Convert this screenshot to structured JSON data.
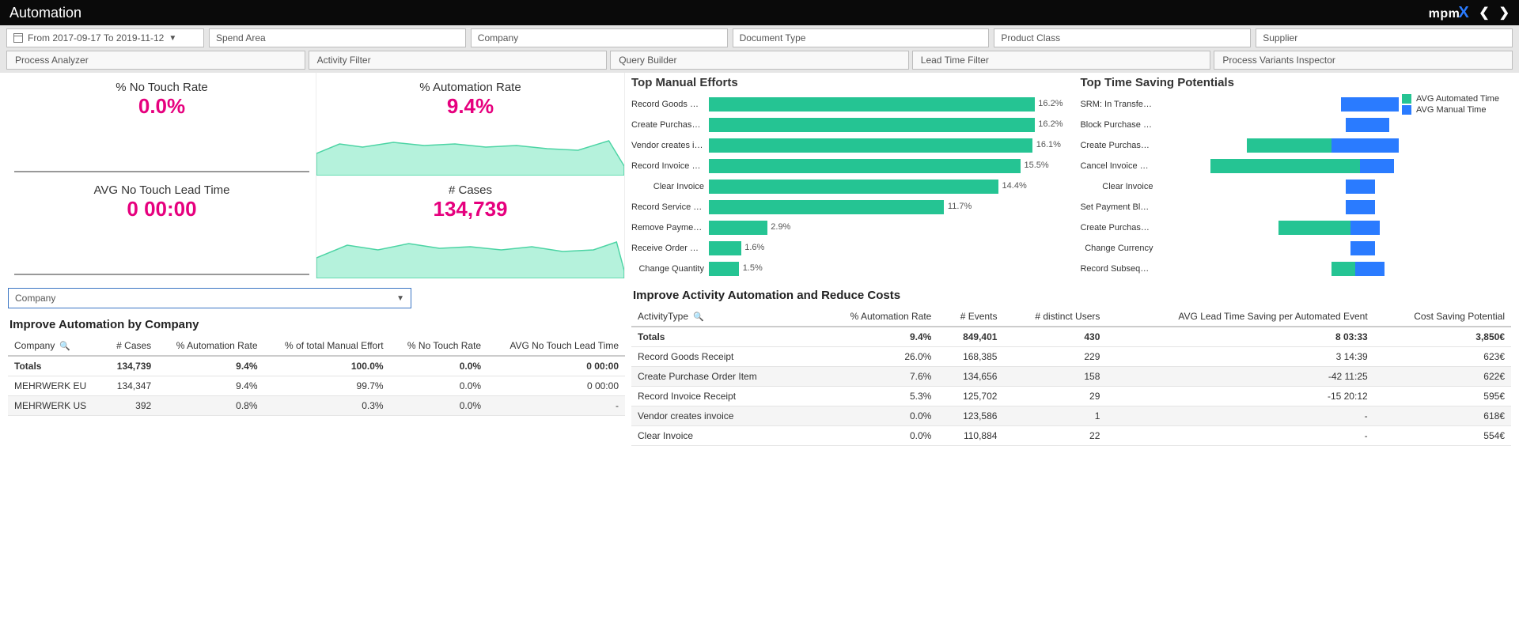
{
  "header": {
    "title": "Automation",
    "logo_text_a": "mpm",
    "logo_text_x": "X"
  },
  "filters": {
    "date": "From 2017-09-17 To 2019-11-12",
    "items": [
      "Spend Area",
      "Company",
      "Document Type",
      "Product Class",
      "Supplier"
    ]
  },
  "tabs": [
    "Process Analyzer",
    "Activity Filter",
    "Query Builder",
    "Lead Time Filter",
    "Process Variants Inspector"
  ],
  "kpis": {
    "noTouchRate": {
      "title": "% No Touch Rate",
      "value": "0.0%"
    },
    "automationRate": {
      "title": "% Automation Rate",
      "value": "9.4%"
    },
    "avgNoTouchLead": {
      "title": "AVG No Touch Lead Time",
      "value": "0 00:00"
    },
    "cases": {
      "title": "# Cases",
      "value": "134,739"
    }
  },
  "dropdown": {
    "label": "Company"
  },
  "companyTable": {
    "title": "Improve Automation by Company",
    "headers": [
      "Company",
      "# Cases",
      "% Automation Rate",
      "% of total Manual Effort",
      "% No Touch Rate",
      "AVG No Touch Lead Time"
    ],
    "totals": [
      "Totals",
      "134,739",
      "9.4%",
      "100.0%",
      "0.0%",
      "0 00:00"
    ],
    "rows": [
      [
        "MEHRWERK EU",
        "134,347",
        "9.4%",
        "99.7%",
        "0.0%",
        "0 00:00"
      ],
      [
        "MEHRWERK US",
        "392",
        "0.8%",
        "0.3%",
        "0.0%",
        "-"
      ]
    ]
  },
  "manualEfforts": {
    "title": "Top Manual Efforts",
    "items": [
      {
        "label": "Record Goods Re...",
        "pct": 16.2
      },
      {
        "label": "Create Purchase ...",
        "pct": 16.2
      },
      {
        "label": "Vendor creates in...",
        "pct": 16.1
      },
      {
        "label": "Record Invoice Re...",
        "pct": 15.5
      },
      {
        "label": "Clear Invoice",
        "pct": 14.4
      },
      {
        "label": "Record Service E...",
        "pct": 11.7
      },
      {
        "label": "Remove Payment...",
        "pct": 2.9
      },
      {
        "label": "Receive Order Co...",
        "pct": 1.6
      },
      {
        "label": "Change Quantity",
        "pct": 1.5
      }
    ]
  },
  "timeSaving": {
    "title": "Top Time Saving Potentials",
    "legend": {
      "auto": "AVG Automated Time",
      "manual": "AVG Manual Time"
    },
    "items": [
      {
        "label": "SRM: In Transfer t...",
        "auto": 0,
        "manual": 24,
        "off": 76
      },
      {
        "label": "Block Purchase O...",
        "auto": 0,
        "manual": 18,
        "off": 78
      },
      {
        "label": "Create Purchase ...",
        "auto": 35,
        "manual": 28,
        "off": 37
      },
      {
        "label": "Cancel Invoice Re...",
        "auto": 62,
        "manual": 14,
        "off": 22
      },
      {
        "label": "Clear Invoice",
        "auto": 0,
        "manual": 12,
        "off": 78
      },
      {
        "label": "Set Payment Block",
        "auto": 0,
        "manual": 12,
        "off": 78
      },
      {
        "label": "Create Purchase ...",
        "auto": 30,
        "manual": 12,
        "off": 50
      },
      {
        "label": "Change Currency",
        "auto": 0,
        "manual": 10,
        "off": 80
      },
      {
        "label": "Record Subseque...",
        "auto": 10,
        "manual": 12,
        "off": 72
      }
    ]
  },
  "activityTable": {
    "title": "Improve Activity Automation and Reduce Costs",
    "headers": [
      "ActivityType",
      "% Automation Rate",
      "# Events",
      "# distinct Users",
      "AVG Lead Time Saving per Automated Event",
      "Cost Saving Potential"
    ],
    "totals": [
      "Totals",
      "9.4%",
      "849,401",
      "430",
      "8 03:33",
      "3,850€"
    ],
    "rows": [
      [
        "Record Goods Receipt",
        "26.0%",
        "168,385",
        "229",
        "3 14:39",
        "623€"
      ],
      [
        "Create Purchase Order Item",
        "7.6%",
        "134,656",
        "158",
        "-42 11:25",
        "622€"
      ],
      [
        "Record Invoice Receipt",
        "5.3%",
        "125,702",
        "29",
        "-15 20:12",
        "595€"
      ],
      [
        "Vendor creates invoice",
        "0.0%",
        "123,586",
        "1",
        "-",
        "618€"
      ],
      [
        "Clear Invoice",
        "0.0%",
        "110,884",
        "22",
        "-",
        "554€"
      ]
    ]
  },
  "chart_data": [
    {
      "type": "bar",
      "orientation": "horizontal",
      "title": "Top Manual Efforts",
      "categories": [
        "Record Goods Re...",
        "Create Purchase ...",
        "Vendor creates in...",
        "Record Invoice Re...",
        "Clear Invoice",
        "Record Service E...",
        "Remove Payment...",
        "Receive Order Co...",
        "Change Quantity"
      ],
      "values": [
        16.2,
        16.2,
        16.1,
        15.5,
        14.4,
        11.7,
        2.9,
        1.6,
        1.5
      ],
      "xlabel": "%",
      "ylabel": "",
      "xlim": [
        0,
        17
      ]
    },
    {
      "type": "bar",
      "orientation": "horizontal",
      "title": "Top Time Saving Potentials",
      "categories": [
        "SRM: In Transfer t...",
        "Block Purchase O...",
        "Create Purchase ...",
        "Cancel Invoice Re...",
        "Clear Invoice",
        "Set Payment Block",
        "Create Purchase ...",
        "Change Currency",
        "Record Subseque..."
      ],
      "series": [
        {
          "name": "AVG Automated Time",
          "values": [
            0,
            0,
            35,
            62,
            0,
            0,
            30,
            0,
            10
          ]
        },
        {
          "name": "AVG Manual Time",
          "values": [
            24,
            18,
            28,
            14,
            12,
            12,
            12,
            10,
            12
          ]
        }
      ],
      "note": "values are approximate relative widths (%) read from the chart"
    },
    {
      "type": "area",
      "title": "% Automation Rate",
      "note": "sparkline, no axis labels"
    },
    {
      "type": "area",
      "title": "# Cases",
      "note": "sparkline, no axis labels"
    }
  ]
}
